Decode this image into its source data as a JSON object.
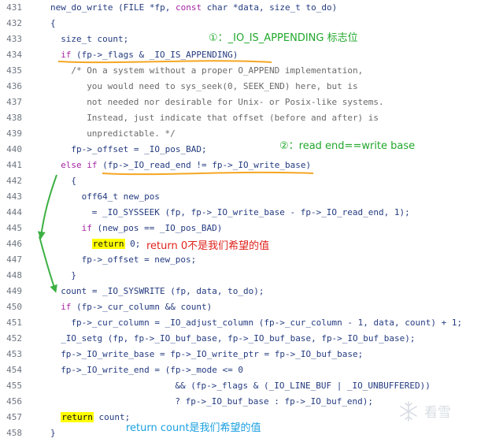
{
  "code": {
    "lines": [
      {
        "n": "431",
        "indent": 0,
        "tokens": [
          [
            "id",
            "new_do_write"
          ],
          [
            "op",
            " (FILE *fp, "
          ],
          [
            "kw",
            "const"
          ],
          [
            "op",
            " char *data, size_t to_do)"
          ]
        ]
      },
      {
        "n": "432",
        "indent": 0,
        "tokens": [
          [
            "op",
            "{"
          ]
        ]
      },
      {
        "n": "433",
        "indent": 2,
        "tokens": [
          [
            "type",
            "size_t"
          ],
          [
            "op",
            " count;"
          ]
        ]
      },
      {
        "n": "434",
        "indent": 2,
        "tokens": [
          [
            "kw",
            "if"
          ],
          [
            "op",
            " (fp->_flags & _IO_IS_APPENDING)"
          ]
        ]
      },
      {
        "n": "435",
        "indent": 4,
        "tokens": [
          [
            "cmt",
            "/* On a system without a proper O_APPEND implementation,"
          ]
        ]
      },
      {
        "n": "436",
        "indent": 7,
        "tokens": [
          [
            "cmt",
            "you would need to sys_seek(0, SEEK_END) here, but is"
          ]
        ]
      },
      {
        "n": "437",
        "indent": 7,
        "tokens": [
          [
            "cmt",
            "not needed nor desirable for Unix- or Posix-like systems."
          ]
        ]
      },
      {
        "n": "438",
        "indent": 7,
        "tokens": [
          [
            "cmt",
            "Instead, just indicate that offset (before and after) is"
          ]
        ]
      },
      {
        "n": "439",
        "indent": 7,
        "tokens": [
          [
            "cmt",
            "unpredictable. */"
          ]
        ]
      },
      {
        "n": "440",
        "indent": 4,
        "tokens": [
          [
            "op",
            "fp->_offset = _IO_pos_BAD;"
          ]
        ]
      },
      {
        "n": "441",
        "indent": 2,
        "tokens": [
          [
            "kw",
            "else if"
          ],
          [
            "op",
            " (fp->_IO_read_end != fp->_IO_write_base)"
          ]
        ]
      },
      {
        "n": "442",
        "indent": 4,
        "tokens": [
          [
            "op",
            "{"
          ]
        ]
      },
      {
        "n": "443",
        "indent": 6,
        "tokens": [
          [
            "type",
            "off64_t"
          ],
          [
            "op",
            " new_pos"
          ]
        ]
      },
      {
        "n": "444",
        "indent": 8,
        "tokens": [
          [
            "op",
            "= _IO_SYSSEEK (fp, fp->_IO_write_base - fp->_IO_read_end, "
          ],
          [
            "num",
            "1"
          ],
          [
            "op",
            ");"
          ]
        ]
      },
      {
        "n": "445",
        "indent": 6,
        "tokens": [
          [
            "kw",
            "if"
          ],
          [
            "op",
            " (new_pos == _IO_pos_BAD)"
          ]
        ]
      },
      {
        "n": "446",
        "indent": 8,
        "tokens": [
          [
            "ret",
            "return"
          ],
          [
            "op",
            " "
          ],
          [
            "num",
            "0"
          ],
          [
            "op",
            ";"
          ]
        ]
      },
      {
        "n": "447",
        "indent": 6,
        "tokens": [
          [
            "op",
            "fp->_offset = new_pos;"
          ]
        ]
      },
      {
        "n": "448",
        "indent": 4,
        "tokens": [
          [
            "op",
            "}"
          ]
        ]
      },
      {
        "n": "449",
        "indent": 2,
        "tokens": [
          [
            "op",
            "count = _IO_SYSWRITE (fp, data, to_do);"
          ]
        ]
      },
      {
        "n": "450",
        "indent": 2,
        "tokens": [
          [
            "kw",
            "if"
          ],
          [
            "op",
            " (fp->_cur_column && count)"
          ]
        ]
      },
      {
        "n": "451",
        "indent": 4,
        "tokens": [
          [
            "op",
            "fp->_cur_column = _IO_adjust_column (fp->_cur_column - "
          ],
          [
            "num",
            "1"
          ],
          [
            "op",
            ", data, count) + "
          ],
          [
            "num",
            "1"
          ],
          [
            "op",
            ";"
          ]
        ]
      },
      {
        "n": "452",
        "indent": 2,
        "tokens": [
          [
            "op",
            "_IO_setg (fp, fp->_IO_buf_base, fp->_IO_buf_base, fp->_IO_buf_base);"
          ]
        ]
      },
      {
        "n": "453",
        "indent": 2,
        "tokens": [
          [
            "op",
            "fp->_IO_write_base = fp->_IO_write_ptr = fp->_IO_buf_base;"
          ]
        ]
      },
      {
        "n": "454",
        "indent": 2,
        "tokens": [
          [
            "op",
            "fp->_IO_write_end = (fp->_mode <= "
          ],
          [
            "num",
            "0"
          ]
        ]
      },
      {
        "n": "455",
        "indent": 24,
        "tokens": [
          [
            "op",
            "&& (fp->_flags & (_IO_LINE_BUF | _IO_UNBUFFERED))"
          ]
        ]
      },
      {
        "n": "456",
        "indent": 24,
        "tokens": [
          [
            "op",
            "? fp->_IO_buf_base : fp->_IO_buf_end);"
          ]
        ]
      },
      {
        "n": "457",
        "indent": 2,
        "tokens": [
          [
            "ret",
            "return"
          ],
          [
            "op",
            " count;"
          ]
        ]
      },
      {
        "n": "458",
        "indent": 0,
        "tokens": [
          [
            "op",
            "}"
          ]
        ]
      }
    ]
  },
  "annotations": {
    "a1": "①：_IO_IS_APPENDING 标志位",
    "a2": "②：read end==write base",
    "a3": "return 0不是我们希望的值",
    "a4": "return count是我们希望的值"
  },
  "watermark": {
    "text": "看雪"
  },
  "colors": {
    "keyword": "#a626a4",
    "identifier": "#243b80",
    "comment": "#6a6a6a",
    "line_number": "#6e7681",
    "return_highlight": "#ffff00",
    "annotation_green": "#22a82c",
    "annotation_red": "#e0241d",
    "annotation_blue": "#1aa0e0",
    "underline_orange": "#f5a623",
    "arrow_green": "#3cb043"
  }
}
